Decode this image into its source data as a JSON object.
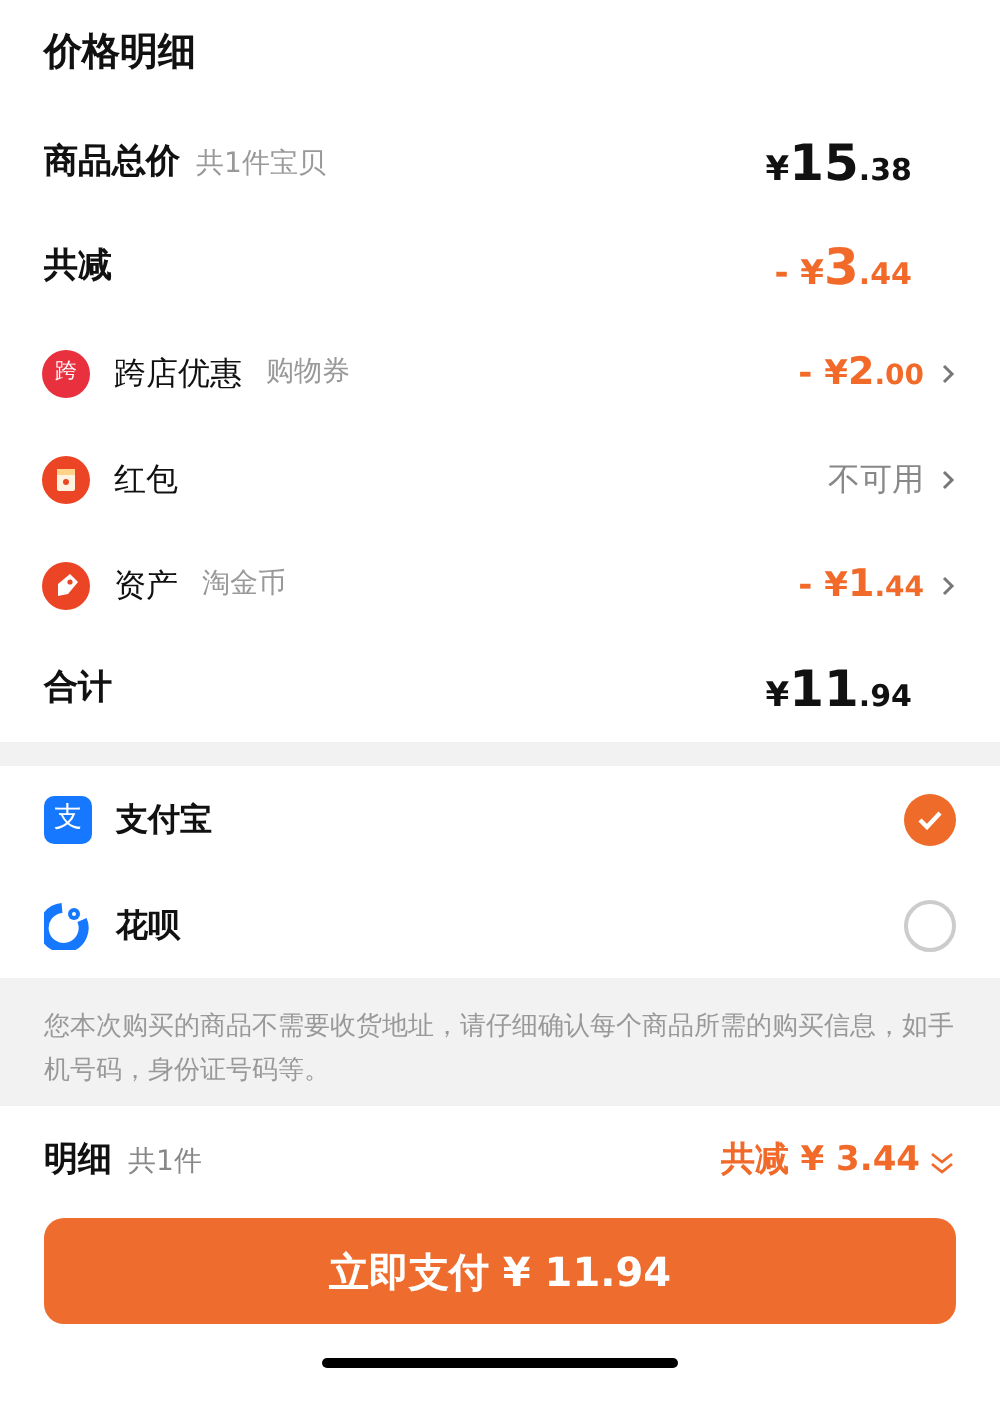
{
  "title": "价格明细",
  "subtotal": {
    "label": "商品总价",
    "note": "共1件宝贝",
    "amount": "¥15.38"
  },
  "reduction": {
    "label": "共减",
    "amount": "- ¥3.44"
  },
  "discounts": [
    {
      "kind": "store",
      "icon_text": "跨",
      "label": "跨店优惠",
      "note": "购物券",
      "amount": "- ¥2.00",
      "available": true
    },
    {
      "kind": "redpacket",
      "label": "红包",
      "amount": "不可用",
      "available": false
    },
    {
      "kind": "asset",
      "label": "资产",
      "note": "淘金币",
      "amount": "- ¥1.44",
      "available": true
    }
  ],
  "total": {
    "label": "合计",
    "amount": "¥11.94"
  },
  "payment_methods": [
    {
      "kind": "alipay",
      "icon_text": "支",
      "label": "支付宝",
      "selected": true
    },
    {
      "kind": "huabei",
      "label": "花呗",
      "selected": false
    }
  ],
  "notice": "您本次购买的商品不需要收货地址，请仔细确认每个商品所需的购买信息，如手机号码，身份证号码等。",
  "summary": {
    "label": "明细",
    "count": "共1件",
    "reduction": "共减 ¥ 3.44"
  },
  "pay_button": "立即支付 ¥ 11.94"
}
